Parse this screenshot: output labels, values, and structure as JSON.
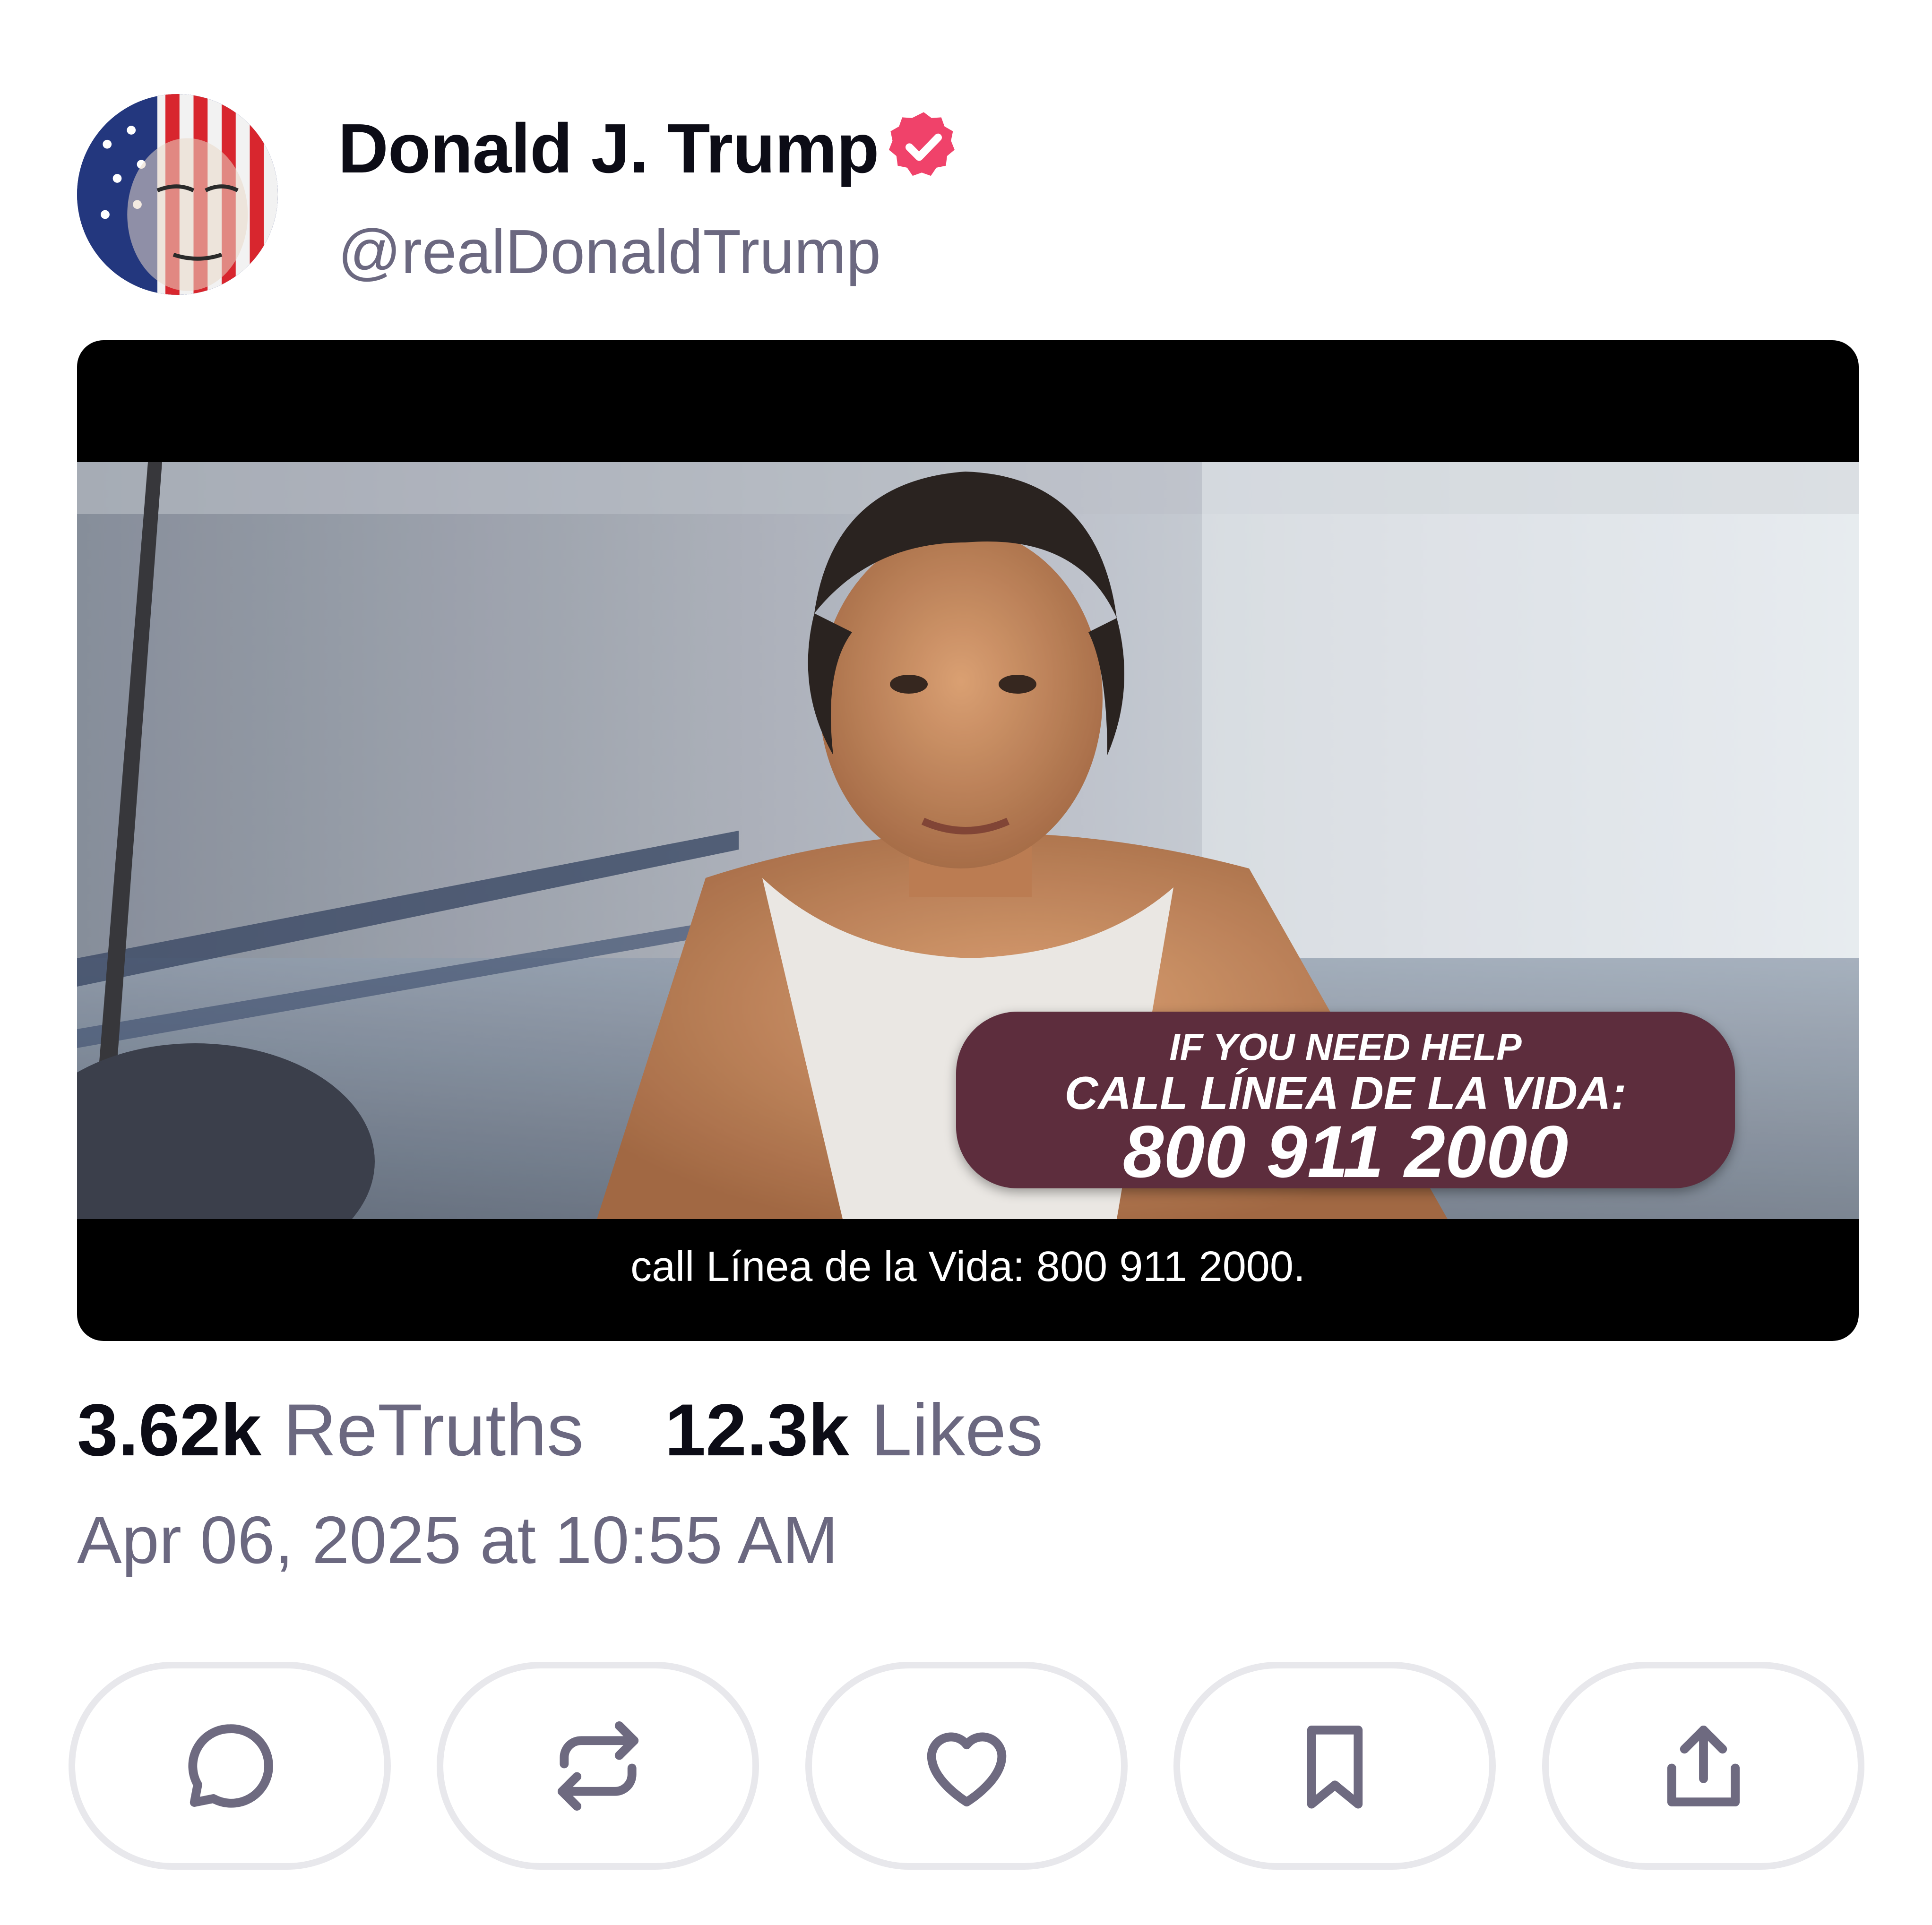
{
  "post": {
    "author_name": "Donald J. Trump",
    "handle": "@realDonaldTrump",
    "verified": true,
    "timestamp": "Apr 06, 2025 at 10:55 AM"
  },
  "media": {
    "overlay": {
      "line1": "IF YOU NEED HELP",
      "line2": "CALL LÍNEA DE LA VIDA:",
      "line3": "800 911 2000"
    },
    "caption": "call Línea de la Vida: 800 911 2000."
  },
  "stats": {
    "retruths_count": "3.62k",
    "retruths_label": "ReTruths",
    "likes_count": "12.3k",
    "likes_label": "Likes"
  },
  "actions": [
    {
      "icon": "reply-icon"
    },
    {
      "icon": "retruth-icon"
    },
    {
      "icon": "heart-icon"
    },
    {
      "icon": "bookmark-icon"
    },
    {
      "icon": "share-icon"
    }
  ],
  "colors": {
    "verified_badge": "#f0426a",
    "overlay_box": "#5d2d3d",
    "muted_text": "#6b6880",
    "button_border": "#e8e8ec"
  }
}
